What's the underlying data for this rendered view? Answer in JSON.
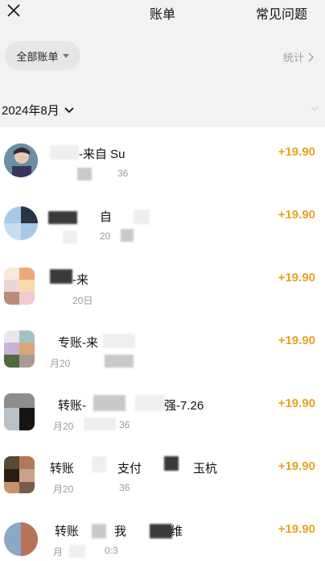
{
  "header": {
    "title": "账单",
    "faq_label": "常见问题"
  },
  "filter": {
    "selected": "全部账单",
    "stats_label": "统计"
  },
  "month": {
    "label": "2024年8月"
  },
  "colors": {
    "amount": "#e6a321",
    "background": "#f2f2f2"
  },
  "transactions": [
    {
      "title": "-来自 Su",
      "subtitle": "36",
      "amount": "+19.90"
    },
    {
      "title": "自",
      "subtitle": "20",
      "amount": "+19.90"
    },
    {
      "title": "-来",
      "subtitle": "20日",
      "amount": "+19.90"
    },
    {
      "title": "专账-来",
      "subtitle": "月20",
      "amount": "+19.90"
    },
    {
      "title": "转账-",
      "title_tail": "强-7.26",
      "subtitle": "月20",
      "subtitle_tail": "36",
      "amount": "+19.90"
    },
    {
      "title": "转账",
      "title_mid": "支付",
      "title_tail": "玉杭",
      "subtitle": "月20",
      "subtitle_tail": "36",
      "amount": "+19.90"
    },
    {
      "title": "转账",
      "title_mid": "我",
      "title_tail": "维",
      "subtitle": "月",
      "subtitle_tail": "0:3",
      "amount": "+19.90"
    }
  ]
}
